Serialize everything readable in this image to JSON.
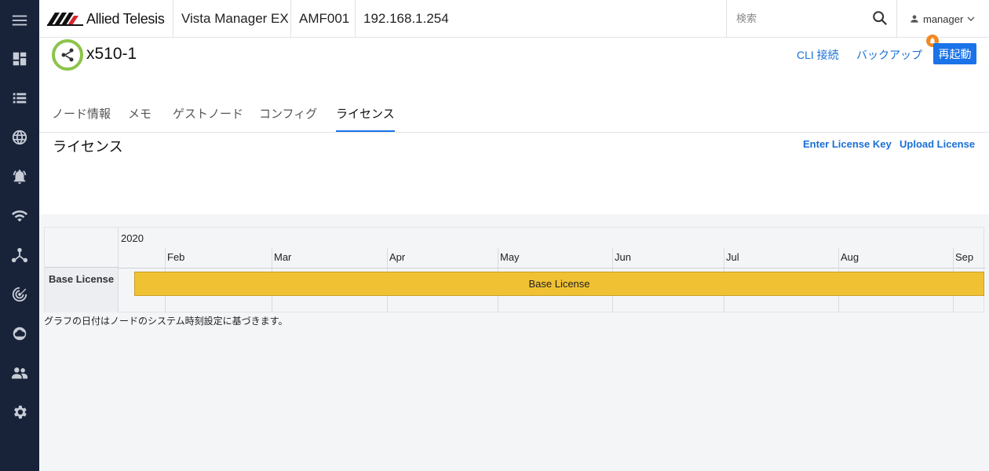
{
  "header": {
    "brand": "Allied Telesis",
    "app_name": "Vista Manager EX",
    "area": "AMF001",
    "ip": "192.168.1.254",
    "search_placeholder": "検索",
    "user": "manager"
  },
  "sidebar": {
    "icons": [
      "menu-icon",
      "dashboard-icon",
      "list-icon",
      "globe-icon",
      "alarm-bell-icon",
      "wifi-icon",
      "topology-icon",
      "radar-icon",
      "cloud-icon",
      "users-icon",
      "settings-gear-icon"
    ]
  },
  "node": {
    "name": "x510-1",
    "actions": {
      "cli": "CLI 接続",
      "backup": "バックアップ",
      "reboot": "再起動"
    }
  },
  "tabs": [
    {
      "label": "ノード情報",
      "active": false
    },
    {
      "label": "メモ",
      "active": false
    },
    {
      "label": "ゲストノード",
      "active": false
    },
    {
      "label": "コンフィグ",
      "active": false
    },
    {
      "label": "ライセンス",
      "active": true
    }
  ],
  "license": {
    "title": "ライセンス",
    "enter_key": "Enter License Key",
    "upload": "Upload License"
  },
  "timeline": {
    "year": "2020",
    "months": [
      "Feb",
      "Mar",
      "Apr",
      "May",
      "Jun",
      "Jul",
      "Aug",
      "Sep"
    ],
    "rows": [
      {
        "label": "Base License",
        "bar_label": "Base License"
      }
    ],
    "bar_color": "#f0c132"
  },
  "note": "グラフの日付はノードのシステム時刻設定に基づきます。",
  "colors": {
    "accent": "#1a73e8",
    "rail": "#18233a",
    "node_ring": "#8cc34a",
    "badge": "#f08a24"
  }
}
